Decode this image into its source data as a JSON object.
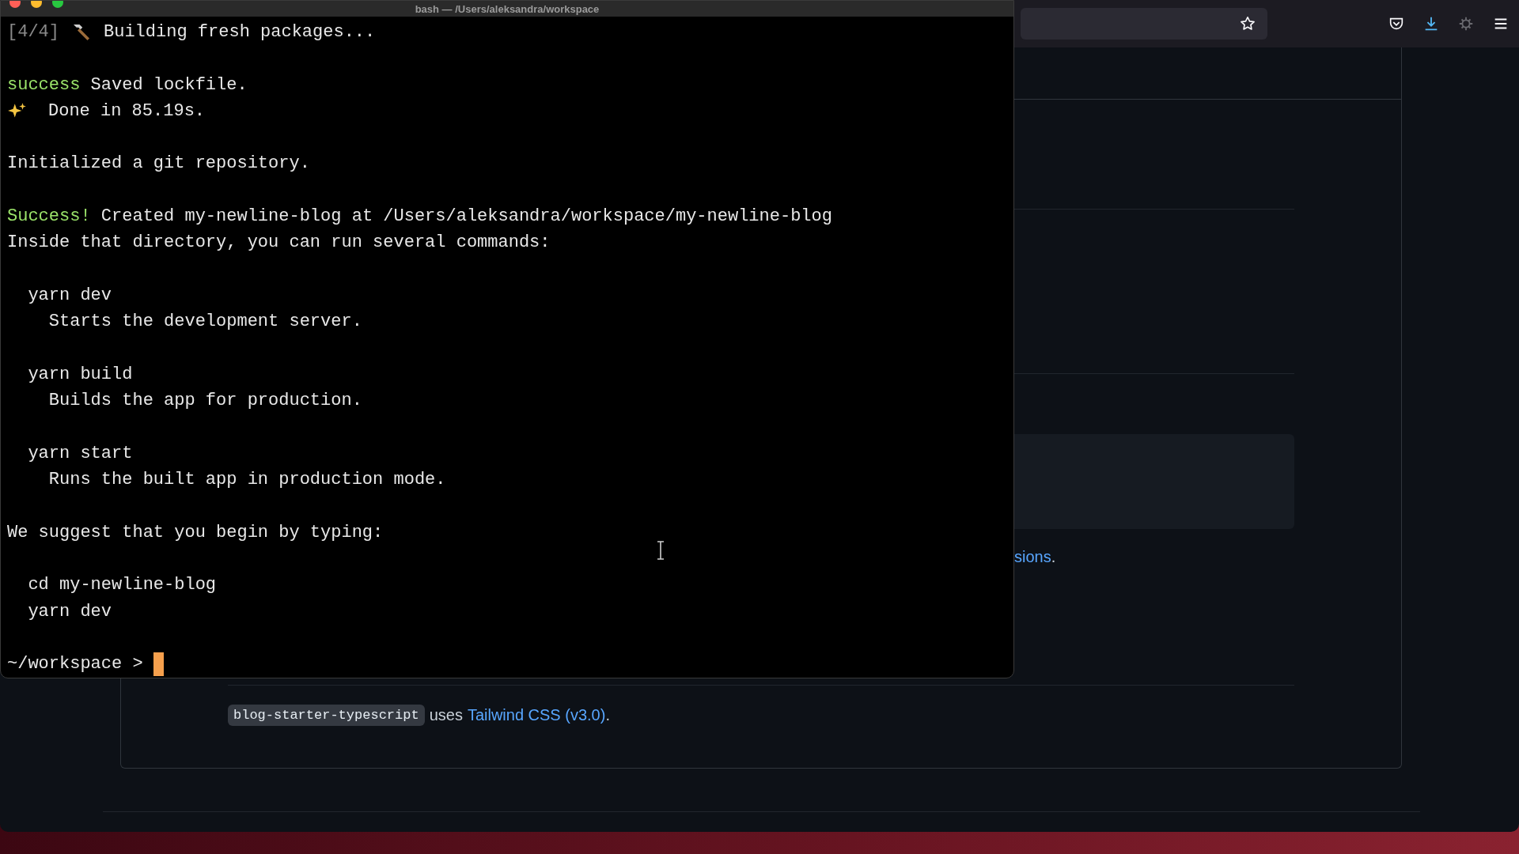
{
  "terminal": {
    "title": "bash — /Users/aleksandra/workspace",
    "blocks": [
      [
        [
          {
            "kind": "dim",
            "text": "[4/4]"
          },
          {
            "kind": "tool_icon"
          },
          {
            "kind": "plain",
            "text": "Building fresh packages..."
          }
        ]
      ],
      [
        [
          {
            "kind": "success",
            "text": "success"
          },
          {
            "kind": "plain",
            "text": " Saved lockfile."
          }
        ],
        [
          {
            "kind": "sparkle_icon"
          },
          {
            "kind": "plain",
            "text": "Done in 85.19s."
          }
        ]
      ],
      [
        [
          {
            "kind": "plain",
            "text": "Initialized a git repository."
          }
        ]
      ],
      [
        [
          {
            "kind": "success",
            "text": "Success!"
          },
          {
            "kind": "plain",
            "text": " Created my-newline-blog at /Users/aleksandra/workspace/my-newline-blog"
          }
        ],
        [
          {
            "kind": "plain",
            "text": "Inside that directory, you can run several commands:"
          }
        ]
      ],
      [
        [
          {
            "kind": "plain",
            "text": "  yarn dev"
          }
        ],
        [
          {
            "kind": "plain",
            "text": "    Starts the development server."
          }
        ]
      ],
      [
        [
          {
            "kind": "plain",
            "text": "  yarn build"
          }
        ],
        [
          {
            "kind": "plain",
            "text": "    Builds the app for production."
          }
        ]
      ],
      [
        [
          {
            "kind": "plain",
            "text": "  yarn start"
          }
        ],
        [
          {
            "kind": "plain",
            "text": "    Runs the built app in production mode."
          }
        ]
      ],
      [
        [
          {
            "kind": "plain",
            "text": "We suggest that you begin by typing:"
          }
        ]
      ],
      [
        [
          {
            "kind": "plain",
            "text": "  cd my-newline-blog"
          }
        ],
        [
          {
            "kind": "plain",
            "text": "  yarn dev"
          }
        ]
      ]
    ],
    "prompt": "~/workspace >"
  },
  "browser": {
    "page": {
      "link_line": {
        "link": "sions",
        "after": "."
      },
      "notes": {
        "code": "blog-starter-typescript",
        "text": "uses",
        "link": "Tailwind CSS (v3.0)",
        "after": "."
      }
    }
  }
}
